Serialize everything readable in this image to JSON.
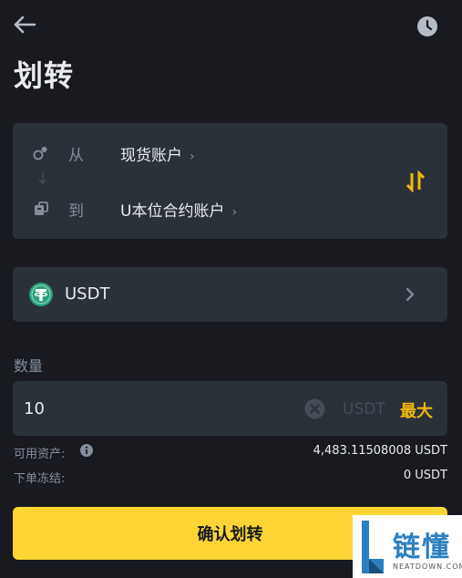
{
  "header": {
    "title": "划转"
  },
  "transfer": {
    "from_label": "从",
    "from_account": "现货账户",
    "to_label": "到",
    "to_account": "U本位合约账户"
  },
  "coin": {
    "name": "USDT"
  },
  "amount": {
    "label": "数量",
    "value": "10",
    "unit": "USDT",
    "max_label": "最大"
  },
  "info": {
    "available_label": "可用资产:",
    "available_value": "4,483.11508008 USDT",
    "frozen_label": "下单冻结:",
    "frozen_value": "0 USDT"
  },
  "confirm": {
    "label": "确认划转"
  },
  "watermark": {
    "text": "链懂",
    "sub": "NEATDOWN.COM"
  },
  "colors": {
    "background": "#181a20",
    "card": "#2b3139",
    "accent": "#f0b90b",
    "button": "#fcd535",
    "tether": "#26a17b"
  },
  "icons": [
    "back-arrow-icon",
    "history-clock-icon",
    "wallet-icon",
    "down-arrow-icon",
    "futures-icon",
    "swap-icon",
    "tether-icon",
    "chevron-right-icon",
    "clear-icon",
    "info-icon"
  ]
}
